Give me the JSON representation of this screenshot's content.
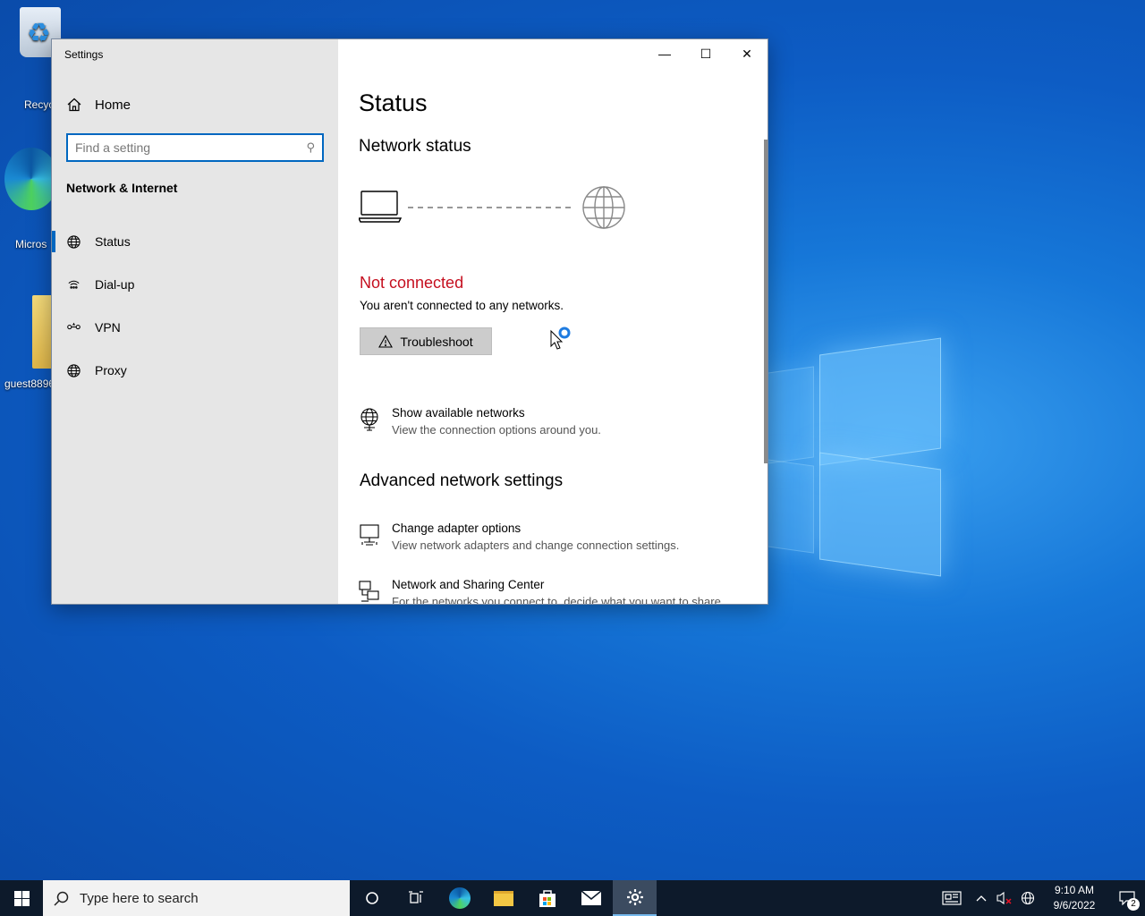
{
  "desktop": {
    "icons": [
      {
        "label": "Recyc"
      },
      {
        "label": "Micros"
      },
      {
        "label": "guest8896"
      }
    ]
  },
  "window": {
    "title": "Settings",
    "caption": {
      "minimize": "—",
      "maximize": "☐",
      "close": "✕"
    }
  },
  "sidebar": {
    "home_label": "Home",
    "search_placeholder": "Find a setting",
    "section_title": "Network & Internet",
    "items": [
      {
        "label": "Status",
        "icon": "globe-icon"
      },
      {
        "label": "Dial-up",
        "icon": "dialup-icon"
      },
      {
        "label": "VPN",
        "icon": "vpn-icon"
      },
      {
        "label": "Proxy",
        "icon": "globe-icon"
      }
    ]
  },
  "main": {
    "title": "Status",
    "network_status_heading": "Network status",
    "status_text": "Not connected",
    "status_desc": "You aren't connected to any networks.",
    "troubleshoot_label": "Troubleshoot",
    "show_networks": {
      "title": "Show available networks",
      "desc": "View the connection options around you."
    },
    "advanced_heading": "Advanced network settings",
    "adapter": {
      "title": "Change adapter options",
      "desc": "View network adapters and change connection settings."
    },
    "sharing": {
      "title": "Network and Sharing Center",
      "desc": "For the networks you connect to, decide what you want to share."
    }
  },
  "taskbar": {
    "search_placeholder": "Type here to search",
    "time": "9:10 AM",
    "date": "9/6/2022",
    "notification_count": "2"
  },
  "colors": {
    "accent": "#0067c0",
    "error": "#c50f1f"
  }
}
